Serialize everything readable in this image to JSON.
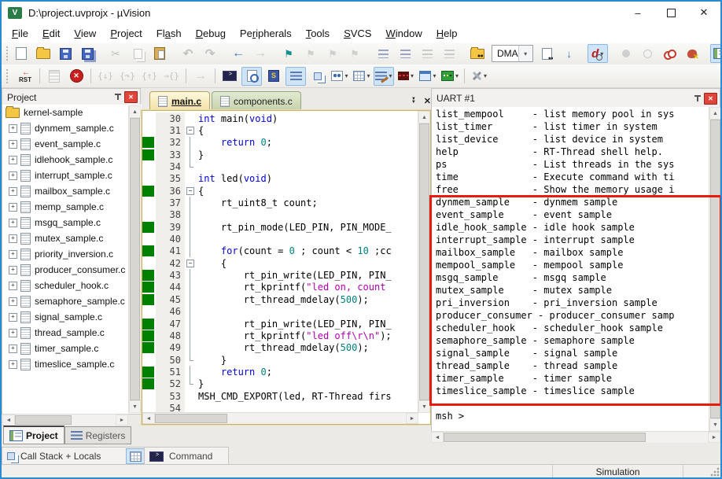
{
  "window": {
    "title": "D:\\project.uvprojx - µVision",
    "controls": {
      "minimize": "–",
      "maximize": "",
      "close": "✕"
    }
  },
  "menu": [
    {
      "label": "File",
      "accel": 0
    },
    {
      "label": "Edit",
      "accel": 0
    },
    {
      "label": "View",
      "accel": 0
    },
    {
      "label": "Project",
      "accel": 0
    },
    {
      "label": "Flash",
      "accel": 2
    },
    {
      "label": "Debug",
      "accel": 0
    },
    {
      "label": "Peripherals",
      "accel": 2
    },
    {
      "label": "Tools",
      "accel": 0
    },
    {
      "label": "SVCS",
      "accel": 0
    },
    {
      "label": "Window",
      "accel": 0
    },
    {
      "label": "Help",
      "accel": 0
    }
  ],
  "toolbars": {
    "search_value": "DMA",
    "row1": [
      {
        "n": "new-file-button",
        "i": "doc"
      },
      {
        "n": "open-file-button",
        "i": "folder"
      },
      {
        "n": "save-button",
        "i": "floppy"
      },
      {
        "n": "save-all-button",
        "i": "floppyall"
      },
      {
        "s": 1
      },
      {
        "n": "cut-button",
        "i": "scissors",
        "dis": 1
      },
      {
        "n": "copy-button",
        "i": "copy",
        "dis": 1
      },
      {
        "n": "paste-button",
        "i": "paste"
      },
      {
        "s": 1
      },
      {
        "n": "undo-button",
        "i": "undo",
        "dis": 1
      },
      {
        "n": "redo-button",
        "i": "redo",
        "dis": 1
      },
      {
        "s": 1
      },
      {
        "n": "navigate-back-button",
        "i": "backblue"
      },
      {
        "n": "navigate-forward-button",
        "i": "fwdgray",
        "dis": 1
      },
      {
        "s": 1
      },
      {
        "n": "toggle-bookmark-button",
        "i": "flagteal"
      },
      {
        "n": "next-bookmark-button",
        "i": "flaggray",
        "dis": 1
      },
      {
        "n": "prev-bookmark-button",
        "i": "flaggray",
        "dis": 1
      },
      {
        "n": "clear-bookmarks-button",
        "i": "flaggrayx",
        "dis": 1
      },
      {
        "s": 1
      },
      {
        "n": "indent-button",
        "i": "indent"
      },
      {
        "n": "outdent-button",
        "i": "outdent"
      },
      {
        "n": "comment-button",
        "i": "comment",
        "dis": 1
      },
      {
        "n": "uncomment-button",
        "i": "uncomment",
        "dis": 1
      },
      {
        "s": 1
      },
      {
        "n": "find-in-files-button",
        "i": "folderfind"
      },
      {
        "combo": 1,
        "n": "search-combobox"
      },
      {
        "n": "find-button",
        "i": "docfind"
      },
      {
        "n": "incremental-find-button",
        "i": "findnext"
      },
      {
        "s": 1
      },
      {
        "n": "start-stop-debug-button",
        "i": "dmag",
        "hl": 1,
        "dd": 1
      },
      {
        "s": 1
      },
      {
        "n": "toggle-breakpoint-button",
        "i": "bpgray",
        "dis": 1
      },
      {
        "n": "enable-disable-breakpoint-button",
        "i": "bphollow",
        "dis": 1
      },
      {
        "n": "disable-all-breakpoints-button",
        "i": "bprings"
      },
      {
        "n": "kill-all-breakpoints-button",
        "i": "bpkill"
      },
      {
        "s": 1
      },
      {
        "n": "project-window-toggle-button",
        "i": "winlist",
        "hl": 1
      }
    ],
    "row2": [
      {
        "n": "reset-cpu-button",
        "i": "rst"
      },
      {
        "s": 1
      },
      {
        "n": "run-button",
        "i": "rundoc",
        "dis": 1
      },
      {
        "n": "stop-button",
        "i": "stopred"
      },
      {
        "s": 1
      },
      {
        "n": "step-into-button",
        "i": "step1",
        "dis": 1
      },
      {
        "n": "step-over-button",
        "i": "step2",
        "dis": 1
      },
      {
        "n": "step-out-button",
        "i": "step3",
        "dis": 1
      },
      {
        "n": "run-to-cursor-button",
        "i": "step4",
        "dis": 1
      },
      {
        "s": 1
      },
      {
        "n": "show-next-statement-button",
        "i": "goarrow",
        "dis": 1
      },
      {
        "s": 1
      },
      {
        "n": "command-window-button",
        "i": "console"
      },
      {
        "n": "disassembly-window-button",
        "i": "docmag",
        "hl": 1
      },
      {
        "n": "symbol-window-button",
        "i": "sdoc"
      },
      {
        "n": "registers-window-button",
        "i": "ham",
        "hl": 1
      },
      {
        "n": "callstack-window-button",
        "i": "sym"
      },
      {
        "n": "watch-window-button",
        "i": "watch",
        "dd": 1
      },
      {
        "n": "memory-window-button",
        "i": "mem",
        "dd": 1
      },
      {
        "n": "serial-window-button",
        "i": "serialpen",
        "hl": 1,
        "dd": 1
      },
      {
        "n": "analysis-window-button",
        "i": "wave",
        "dd": 1
      },
      {
        "n": "system-viewer-button",
        "i": "sysv",
        "dd": 1
      },
      {
        "n": "toolbox-button",
        "i": "toolbox",
        "dd": 1
      },
      {
        "s": 1
      },
      {
        "n": "tools-menu-button",
        "i": "wrench",
        "dd": 1
      }
    ]
  },
  "project": {
    "title": "Project",
    "root": "kernel-sample",
    "files": [
      "dynmem_sample.c",
      "event_sample.c",
      "idlehook_sample.c",
      "interrupt_sample.c",
      "mailbox_sample.c",
      "memp_sample.c",
      "msgq_sample.c",
      "mutex_sample.c",
      "priority_inversion.c",
      "producer_consumer.c",
      "scheduler_hook.c",
      "semaphore_sample.c",
      "signal_sample.c",
      "thread_sample.c",
      "timer_sample.c",
      "timeslice_sample.c"
    ],
    "tabs": [
      {
        "label": "Project",
        "active": true
      },
      {
        "label": "Registers",
        "active": false
      }
    ],
    "callstack_label": "Call Stack + Locals"
  },
  "editor": {
    "tabs": [
      {
        "label": "main.c",
        "active": true
      },
      {
        "label": "components.c",
        "active": false
      }
    ],
    "command_tab": "Command",
    "lines": [
      {
        "n": 30,
        "fold": "",
        "exec": false,
        "segs": [
          [
            "k",
            "int"
          ],
          [
            "p",
            " main("
          ],
          [
            "k",
            "void"
          ],
          [
            "p",
            ")"
          ]
        ]
      },
      {
        "n": 31,
        "fold": "box",
        "exec": false,
        "segs": [
          [
            "p",
            "{"
          ]
        ]
      },
      {
        "n": 32,
        "fold": "line",
        "exec": true,
        "segs": [
          [
            "p",
            "    "
          ],
          [
            "k",
            "return"
          ],
          [
            "p",
            " "
          ],
          [
            "num",
            "0"
          ],
          [
            "p",
            ";"
          ]
        ]
      },
      {
        "n": 33,
        "fold": "line",
        "exec": true,
        "segs": [
          [
            "p",
            "}"
          ]
        ]
      },
      {
        "n": 34,
        "fold": "end",
        "exec": false,
        "segs": []
      },
      {
        "n": 35,
        "fold": "",
        "exec": false,
        "segs": [
          [
            "k",
            "int"
          ],
          [
            "p",
            " led("
          ],
          [
            "k",
            "void"
          ],
          [
            "p",
            ")"
          ]
        ]
      },
      {
        "n": 36,
        "fold": "box",
        "exec": true,
        "segs": [
          [
            "p",
            "{"
          ]
        ]
      },
      {
        "n": 37,
        "fold": "line",
        "exec": false,
        "segs": [
          [
            "p",
            "    rt_uint8_t count;"
          ]
        ]
      },
      {
        "n": 38,
        "fold": "line",
        "exec": false,
        "segs": []
      },
      {
        "n": 39,
        "fold": "line",
        "exec": true,
        "segs": [
          [
            "p",
            "    rt_pin_mode(LED_PIN, PIN_MODE_"
          ]
        ]
      },
      {
        "n": 40,
        "fold": "line",
        "exec": false,
        "segs": []
      },
      {
        "n": 41,
        "fold": "line",
        "exec": true,
        "segs": [
          [
            "p",
            "    "
          ],
          [
            "k",
            "for"
          ],
          [
            "p",
            "(count = "
          ],
          [
            "num",
            "0"
          ],
          [
            "p",
            " ; count < "
          ],
          [
            "num",
            "10"
          ],
          [
            "p",
            " ;cc"
          ]
        ]
      },
      {
        "n": 42,
        "fold": "box2",
        "exec": false,
        "segs": [
          [
            "p",
            "    {"
          ]
        ]
      },
      {
        "n": 43,
        "fold": "line",
        "exec": true,
        "segs": [
          [
            "p",
            "        rt_pin_write(LED_PIN, PIN_"
          ]
        ]
      },
      {
        "n": 44,
        "fold": "line",
        "exec": true,
        "segs": [
          [
            "p",
            "        rt_kprintf("
          ],
          [
            "s",
            "\"led on, count"
          ]
        ]
      },
      {
        "n": 45,
        "fold": "line",
        "exec": true,
        "segs": [
          [
            "p",
            "        rt_thread_mdelay("
          ],
          [
            "num",
            "500"
          ],
          [
            "p",
            ");"
          ]
        ]
      },
      {
        "n": 46,
        "fold": "line",
        "exec": false,
        "segs": []
      },
      {
        "n": 47,
        "fold": "line",
        "exec": true,
        "segs": [
          [
            "p",
            "        rt_pin_write(LED_PIN, PIN_"
          ]
        ]
      },
      {
        "n": 48,
        "fold": "line",
        "exec": true,
        "segs": [
          [
            "p",
            "        rt_kprintf("
          ],
          [
            "s",
            "\"led off\\r\\n\""
          ],
          [
            "p",
            ");"
          ]
        ]
      },
      {
        "n": 49,
        "fold": "line",
        "exec": true,
        "segs": [
          [
            "p",
            "        rt_thread_mdelay("
          ],
          [
            "num",
            "500"
          ],
          [
            "p",
            ");"
          ]
        ]
      },
      {
        "n": 50,
        "fold": "end",
        "exec": false,
        "segs": [
          [
            "p",
            "    }"
          ]
        ]
      },
      {
        "n": 51,
        "fold": "line",
        "exec": true,
        "segs": [
          [
            "p",
            "    "
          ],
          [
            "k",
            "return"
          ],
          [
            "p",
            " "
          ],
          [
            "num",
            "0"
          ],
          [
            "p",
            ";"
          ]
        ]
      },
      {
        "n": 52,
        "fold": "end",
        "exec": true,
        "segs": [
          [
            "p",
            "}"
          ]
        ]
      },
      {
        "n": 53,
        "fold": "",
        "exec": false,
        "segs": [
          [
            "p",
            "MSH_CMD_EXPORT(led, RT-Thread firs"
          ]
        ]
      },
      {
        "n": 54,
        "fold": "",
        "exec": false,
        "segs": []
      }
    ]
  },
  "uart": {
    "title": "UART #1",
    "lines_top": [
      "list_mempool     - list memory pool in sys",
      "list_timer       - list timer in system",
      "list_device      - list device in system",
      "help             - RT-Thread shell help.",
      "ps               - List threads in the sys",
      "time             - Execute command with ti",
      "free             - Show the memory usage i"
    ],
    "lines_highlighted": [
      "dynmem_sample    - dynmem sample",
      "event_sample     - event sample",
      "idle_hook_sample - idle hook sample",
      "interrupt_sample - interrupt sample",
      "mailbox_sample   - mailbox sample",
      "mempool_sample   - mempool sample",
      "msgq_sample      - msgq sample",
      "mutex_sample     - mutex sample",
      "pri_inversion    - pri_inversion sample",
      "producer_consumer - producer_consumer samp",
      "scheduler_hook   - scheduler_hook sample",
      "semaphore_sample - semaphore sample",
      "signal_sample    - signal sample",
      "thread_sample    - thread sample",
      "timer_sample     - timer sample",
      "timeslice_sample - timeslice sample"
    ],
    "prompt": "msh >",
    "highlight_color": "#e81c0e"
  },
  "status": {
    "mode": "Simulation"
  },
  "icons_legend": {
    "app-icon-glyph": "V",
    "cut": "✂",
    "undo": "↶",
    "redo": "↷",
    "back": "←",
    "forward": "→",
    "bookmark-flag": "⚑",
    "dropdown": "▾",
    "scroll-up": "▲",
    "scroll-down": "▼",
    "scroll-left": "◄",
    "scroll-right": "►",
    "expander": "+",
    "fold-collapse": "−",
    "console-prompt": ">",
    "stop-cross": "✕",
    "rst-label": "RST"
  }
}
